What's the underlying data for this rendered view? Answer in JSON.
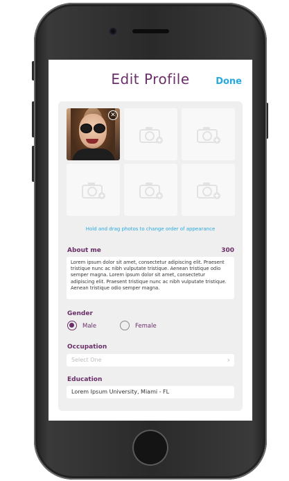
{
  "header": {
    "title": "Edit Profile",
    "done_label": "Done"
  },
  "photos": {
    "hint": "Hold and drag photos to change order of appearance",
    "tiles": [
      {
        "filled": true
      },
      {
        "filled": false
      },
      {
        "filled": false
      },
      {
        "filled": false
      },
      {
        "filled": false
      },
      {
        "filled": false
      }
    ]
  },
  "about": {
    "label": "About me",
    "count": "300",
    "text": "Lorem ipsum dolor sit amet, consectetur adipiscing elit. Praesent tristique nunc ac nibh vulputate tristique. Aenean tristique odio semper magna. Lorem ipsum dolor sit amet, consectetur adipiscing elit. Praesent tristique nunc ac nibh vulputate tristique. Aenean tristique odio semper magna."
  },
  "gender": {
    "label": "Gender",
    "options": [
      {
        "label": "Male",
        "selected": true
      },
      {
        "label": "Female",
        "selected": false
      }
    ]
  },
  "occupation": {
    "label": "Occupation",
    "placeholder": "Select One"
  },
  "education": {
    "label": "Education",
    "value": "Lorem Ipsum University, Miami - FL"
  },
  "colors": {
    "accent": "#6a2f68",
    "link": "#29a8e0",
    "panel": "#efefef"
  }
}
